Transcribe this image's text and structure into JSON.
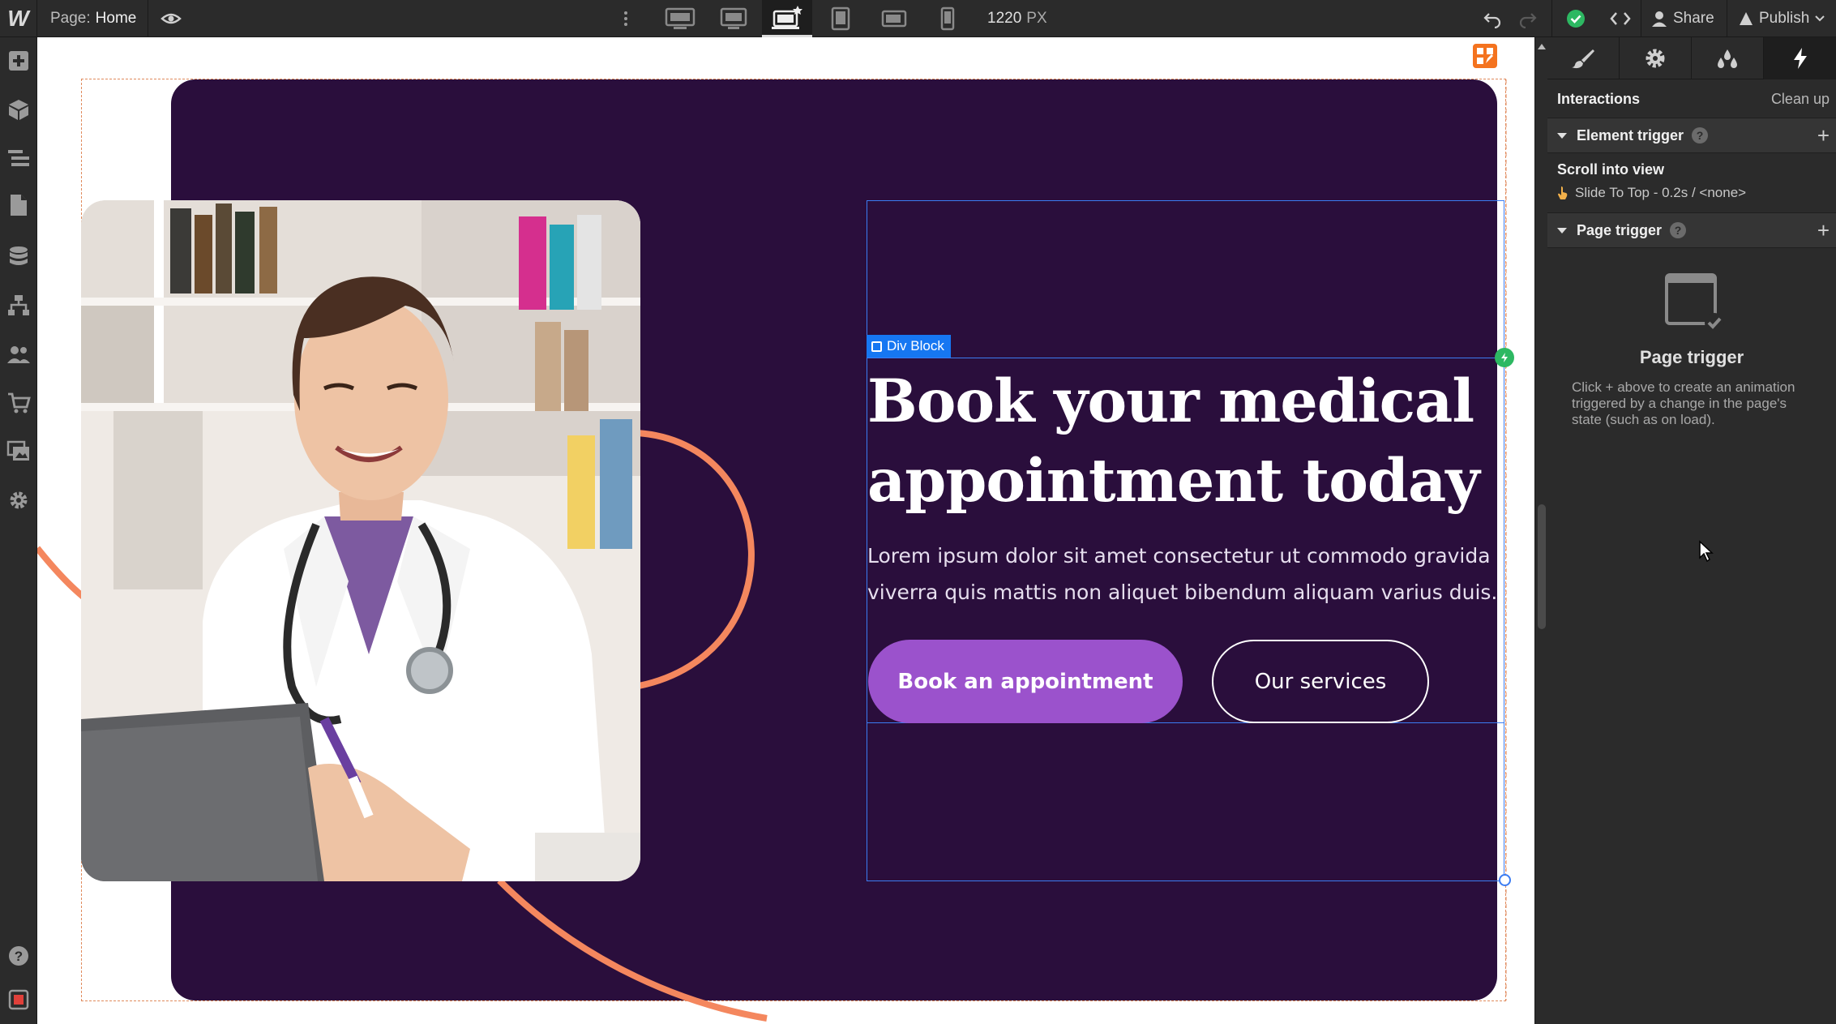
{
  "topbar": {
    "logo": "W",
    "page_label": "Page:",
    "page_name": "Home",
    "canvas_width": "1220",
    "canvas_unit": "PX",
    "share_label": "Share",
    "publish_label": "Publish"
  },
  "left_toolbar": {
    "items": [
      "add-panel",
      "components",
      "navigator",
      "pages",
      "cms",
      "logic",
      "users",
      "ecommerce",
      "assets",
      "settings",
      "help",
      "video-tutorials"
    ]
  },
  "canvas": {
    "div_block_label": "Div Block",
    "headline": "Book your medical appointment today",
    "paragraph": "Lorem ipsum dolor sit amet consectetur ut commodo gravida viverra quis mattis non aliquet bibendum aliquam varius duis.",
    "primary_button": "Book an appointment",
    "secondary_button": "Our services",
    "colors": {
      "hero_bg": "#2a0e3c",
      "accent_purple": "#9b52cc",
      "accent_orange": "#f4875e"
    }
  },
  "right_panel": {
    "title": "Interactions",
    "cleanup": "Clean up",
    "element_trigger": {
      "label": "Element trigger",
      "item_title": "Scroll into view",
      "item_detail": "Slide To Top - 0.2s / <none>"
    },
    "page_trigger": {
      "label": "Page trigger",
      "empty_title": "Page trigger",
      "empty_desc": "Click + above to create an animation triggered by a change in the page's state (such as on load)."
    }
  }
}
